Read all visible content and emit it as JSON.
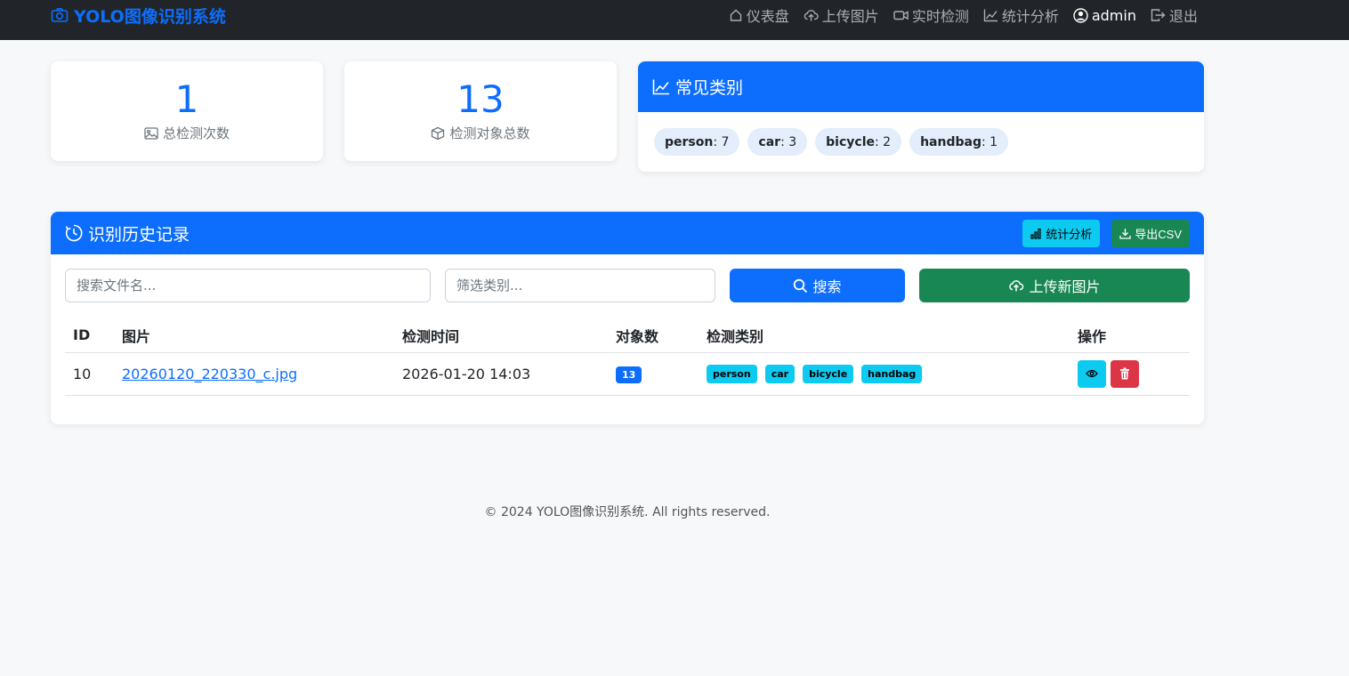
{
  "brand": {
    "title": "YOLO图像识别系统",
    "icon": "camera-icon"
  },
  "nav": {
    "items": [
      {
        "label": "仪表盘",
        "icon": "house-icon"
      },
      {
        "label": "上传图片",
        "icon": "cloud-upload-icon"
      },
      {
        "label": "实时检测",
        "icon": "camera-video-icon"
      },
      {
        "label": "统计分析",
        "icon": "graph-up-icon"
      }
    ],
    "user": {
      "label": "admin",
      "icon": "person-circle-icon"
    },
    "logout": {
      "label": "退出",
      "icon": "box-arrow-right-icon"
    }
  },
  "stats": [
    {
      "value": "1",
      "label": "总检测次数",
      "icon": "image-icon"
    },
    {
      "value": "13",
      "label": "检测对象总数",
      "icon": "box-icon"
    }
  ],
  "categories": {
    "title": "常见类别",
    "icon": "graph-up-icon",
    "items": [
      {
        "name": "person",
        "count": ": 7"
      },
      {
        "name": "car",
        "count": ": 3"
      },
      {
        "name": "bicycle",
        "count": ": 2"
      },
      {
        "name": "handbag",
        "count": ": 1"
      }
    ]
  },
  "history": {
    "title": "识别历史记录",
    "icon": "clock-history-icon",
    "stats_button": "统计分析",
    "export_button": "导出CSV",
    "search_placeholder": "搜索文件名...",
    "filter_placeholder": "筛选类别...",
    "search_button": "搜索",
    "upload_button": "上传新图片",
    "columns": [
      "ID",
      "图片",
      "检测时间",
      "对象数",
      "检测类别",
      "操作"
    ],
    "rows": [
      {
        "id": "10",
        "image": "20260120_220330_c.jpg",
        "time": "2026-01-20 14:03",
        "count": "13",
        "classes": [
          "person",
          "car",
          "bicycle",
          "handbag"
        ]
      }
    ]
  },
  "footer": "© 2024 YOLO图像识别系统. All rights reserved.",
  "colors": {
    "primary": "#0d6efd",
    "info": "#0dcaf0",
    "success": "#198754",
    "danger": "#dc3545",
    "navbar": "#212529"
  }
}
